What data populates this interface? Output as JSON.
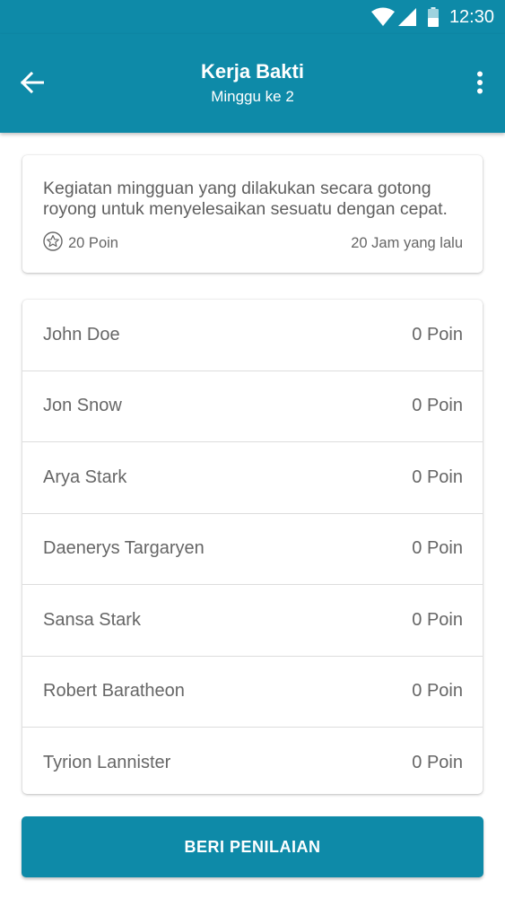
{
  "status_bar": {
    "time": "12:30",
    "icons": [
      "wifi-icon",
      "signal-icon",
      "battery-icon"
    ]
  },
  "app_bar": {
    "title": "Kerja Bakti",
    "subtitle": "Minggu ke 2",
    "back_icon": "arrow-left-icon",
    "menu_icon": "more-vertical-icon"
  },
  "task": {
    "description": "Kegiatan mingguan yang dilakukan secara gotong royong untuk menyelesaikan sesuatu dengan cepat.",
    "points": "20 Poin",
    "points_icon": "star-icon",
    "time_ago": "20 Jam yang lalu"
  },
  "members": [
    {
      "name": "John Doe",
      "points": "0 Poin"
    },
    {
      "name": "Jon Snow",
      "points": "0 Poin"
    },
    {
      "name": "Arya Stark",
      "points": "0 Poin"
    },
    {
      "name": "Daenerys Targaryen",
      "points": "0 Poin"
    },
    {
      "name": "Sansa Stark",
      "points": "0 Poin"
    },
    {
      "name": "Robert Baratheon",
      "points": "0 Poin"
    },
    {
      "name": "Tyrion Lannister",
      "points": "0 Poin"
    }
  ],
  "actions": {
    "rate_label": "BERI PENILAIAN"
  },
  "colors": {
    "primary": "#0e8aa8",
    "text": "#666666",
    "divider": "#dddddd"
  }
}
